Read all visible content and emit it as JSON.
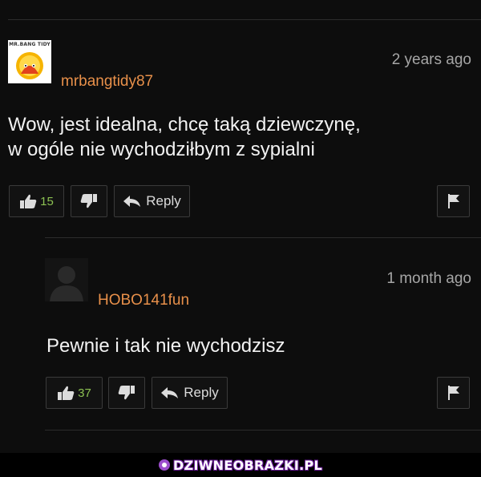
{
  "comments": [
    {
      "avatar_caption": "MR.BANG TIDY",
      "username": "mrbangtidy87",
      "timestamp": "2 years ago",
      "text_lines": [
        "Wow, jest idealna, chcę taką dziewczynę,",
        "w ogóle nie wychodziłbym z sypialni"
      ],
      "upvotes": "15",
      "reply_label": "Reply"
    },
    {
      "username": "HOBO141fun",
      "timestamp": "1 month ago",
      "text_lines": [
        "Pewnie i tak nie wychodzisz"
      ],
      "upvotes": "37",
      "reply_label": "Reply"
    }
  ],
  "watermark": "DZIWNEOBRAZKI.PL",
  "colors": {
    "background": "#0d0d0d",
    "username": "#e8904a",
    "vote_count": "#8cc152",
    "timestamp": "#a6a6a6"
  },
  "icons": [
    "thumbs-up-icon",
    "thumbs-down-icon",
    "reply-arrow-icon",
    "flag-icon"
  ]
}
